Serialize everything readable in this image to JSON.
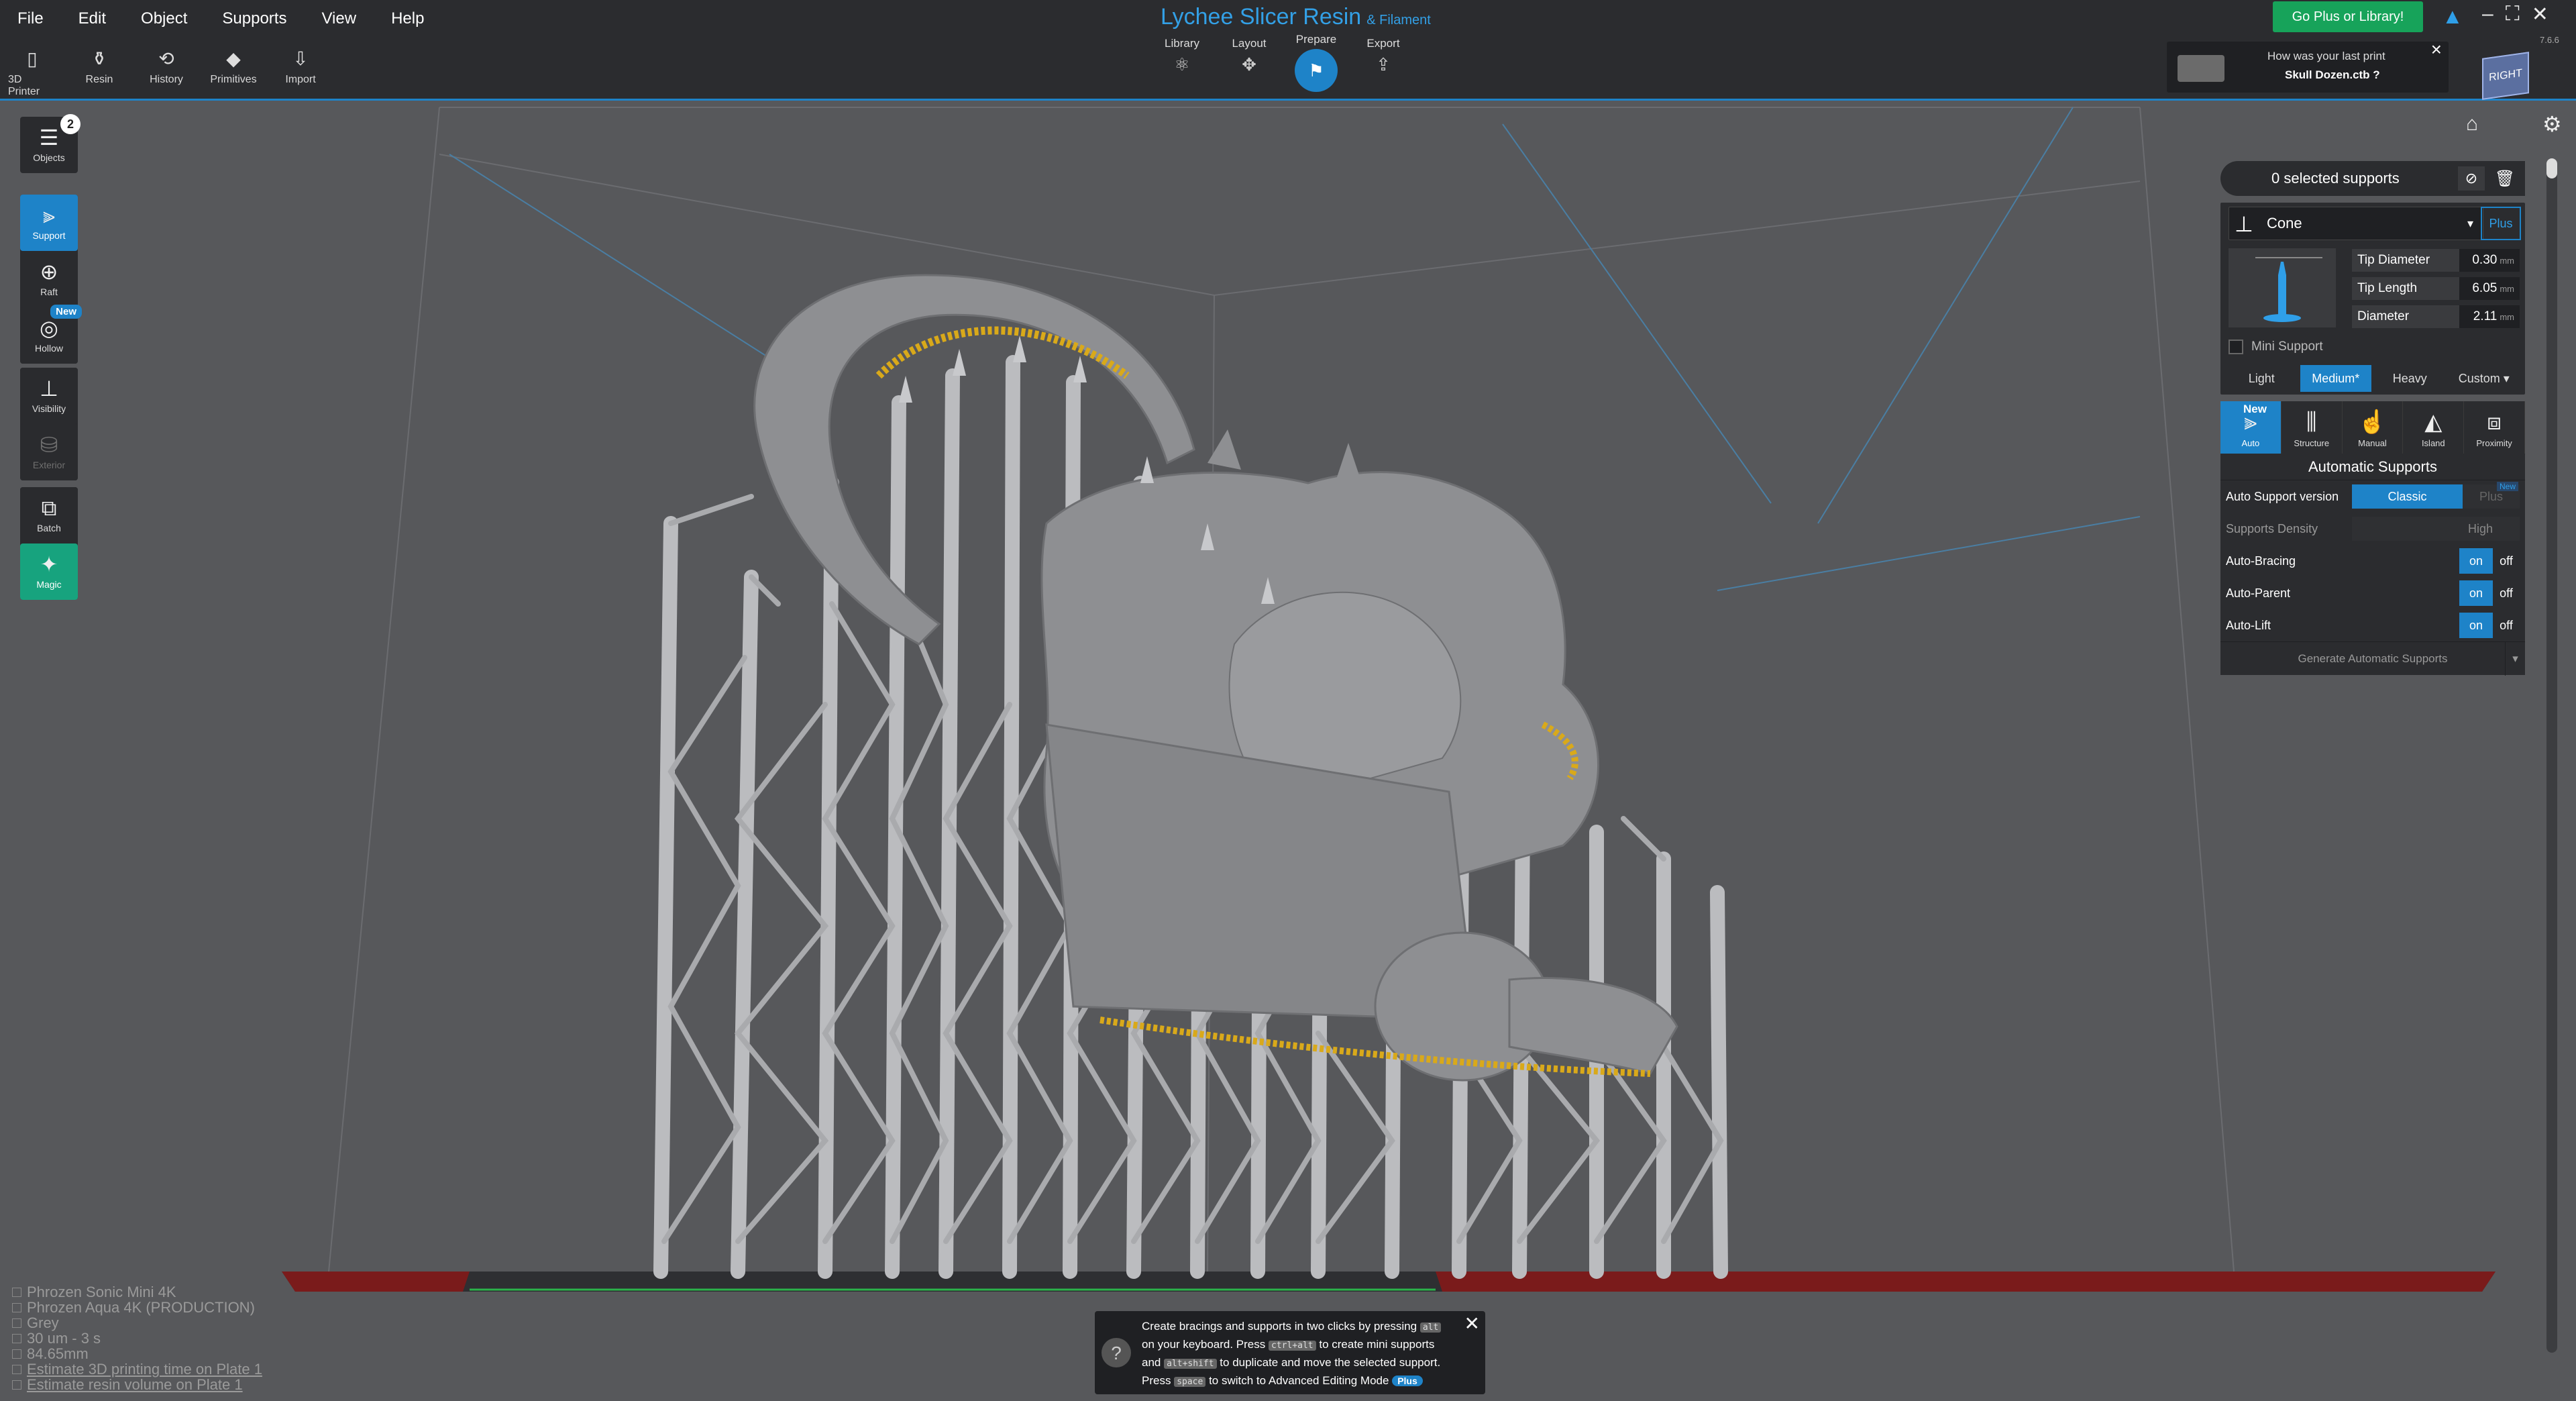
{
  "menu": [
    "File",
    "Edit",
    "Object",
    "Supports",
    "View",
    "Help"
  ],
  "brand": {
    "name": "Lychee Slicer Resin",
    "suffix": "& Filament"
  },
  "toolbar": [
    {
      "label": "3D Printer",
      "icon": "printer-icon",
      "glyph": "▯"
    },
    {
      "label": "Resin",
      "icon": "resin-bottle-icon",
      "glyph": "⚱"
    },
    {
      "label": "History",
      "icon": "history-icon",
      "glyph": "⟲"
    },
    {
      "label": "Primitives",
      "icon": "primitives-icon",
      "glyph": "◆"
    },
    {
      "label": "Import",
      "icon": "import-icon",
      "glyph": "⇩"
    }
  ],
  "steps": [
    {
      "label": "Library",
      "icon": "library-icon",
      "glyph": "⚛"
    },
    {
      "label": "Layout",
      "icon": "layout-move-icon",
      "glyph": "✥"
    },
    {
      "label": "Prepare",
      "icon": "prepare-icon",
      "glyph": "⚑",
      "active": true
    },
    {
      "label": "Export",
      "icon": "export-icon",
      "glyph": "⇪"
    }
  ],
  "go_plus": "Go Plus or Library!",
  "version": "7.6.6",
  "last_print": {
    "question": "How was your last print",
    "file": "Skull Dozen.ctb ?"
  },
  "view_cube": "RIGHT",
  "left_tools": {
    "objects": {
      "label": "Objects",
      "count": "2"
    },
    "support": "Support",
    "raft": "Raft",
    "hollow": "Hollow",
    "new_tag": "New",
    "visibility": "Visibility",
    "exterior": "Exterior",
    "batch": "Batch",
    "magic": "Magic"
  },
  "support_panel": {
    "selected": "0 selected supports",
    "shape": "Cone",
    "plus": "Plus",
    "params": [
      {
        "label": "Tip Diameter",
        "value": "0.30",
        "unit": "mm"
      },
      {
        "label": "Tip Length",
        "value": "6.05",
        "unit": "mm"
      },
      {
        "label": "Diameter",
        "value": "2.11",
        "unit": "mm"
      }
    ],
    "mini_support": "Mini Support",
    "density": [
      "Light",
      "Medium*",
      "Heavy",
      "Custom ▾"
    ],
    "density_active": 1,
    "tabs": [
      "Auto",
      "Structure",
      "Manual",
      "Island",
      "Proximity"
    ],
    "tab_new": "New",
    "auto_title": "Automatic Supports",
    "auto_version_label": "Auto Support version",
    "auto_version_classic": "Classic",
    "auto_version_plus": "Plus",
    "auto_version_new": "New",
    "density_label": "Supports Density",
    "density_value": "High",
    "toggles": [
      {
        "label": "Auto-Bracing",
        "on": "on",
        "off": "off"
      },
      {
        "label": "Auto-Parent",
        "on": "on",
        "off": "off"
      },
      {
        "label": "Auto-Lift",
        "on": "on",
        "off": "off"
      }
    ],
    "generate": "Generate Automatic Supports"
  },
  "info": [
    "Phrozen Sonic Mini 4K",
    "Phrozen Aqua 4K (PRODUCTION)",
    "Grey",
    "30 um - 3 s",
    "84.65mm",
    "Estimate 3D printing time on Plate 1",
    "Estimate resin volume on Plate 1"
  ],
  "tip": {
    "l1a": "Create bracings and supports in two clicks by pressing",
    "k1": "alt",
    "l2a": "on your keyboard. Press",
    "k2": "ctrl+alt",
    "l2b": "to create mini supports",
    "l3a": "and",
    "k3": "alt+shift",
    "l3b": "to duplicate and move the selected support.",
    "l4a": "Press",
    "k4": "space",
    "l4b": "to switch to Advanced Editing Mode",
    "plus": "Plus"
  },
  "colors": {
    "accent": "#1e83c8",
    "magic": "#17a37e",
    "go_plus": "#17a35a",
    "contact_points": "#d9a91a",
    "model": "#8e8f92"
  }
}
